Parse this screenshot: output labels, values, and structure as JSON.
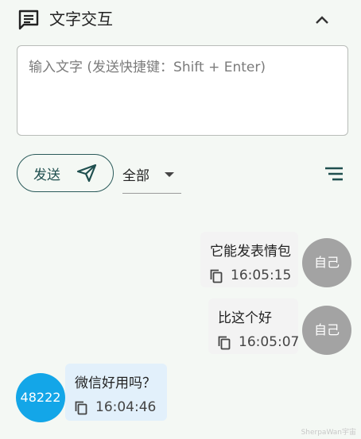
{
  "header": {
    "title": "文字交互"
  },
  "input": {
    "placeholder": "输入文字 (发送快捷键：Shift + Enter)",
    "value": ""
  },
  "toolbar": {
    "send_label": "发送",
    "filter_value": "全部"
  },
  "messages": [
    {
      "sender": "自己",
      "text": "它能发表情包",
      "time": "16:05:15"
    },
    {
      "sender": "自己",
      "text": "比这个好",
      "time": "16:05:07"
    },
    {
      "sender": "48222",
      "text": "微信好用吗？",
      "time": "16:04:46"
    }
  ],
  "watermark": "SherpaWan宇宙",
  "colors": {
    "accent": "#1f4f4f",
    "self_avatar": "#a3a3a3",
    "other_avatar": "#13a6e8",
    "other_bubble": "#e2f0fb",
    "self_bubble": "#f3f3f3"
  }
}
